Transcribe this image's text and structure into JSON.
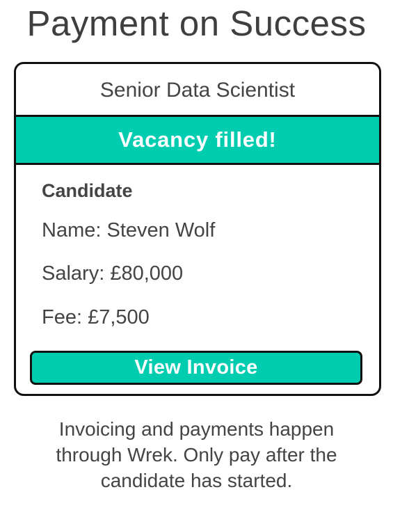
{
  "page": {
    "title": "Payment on Success"
  },
  "card": {
    "job_title": "Senior Data Scientist",
    "status": "Vacancy filled!",
    "candidate_heading": "Candidate",
    "name": "Name: Steven Wolf",
    "salary": "Salary: £80,000",
    "fee": "Fee: £7,500",
    "invoice_button_label": "View Invoice"
  },
  "footer": {
    "description": "Invoicing and payments happen through Wrek. Only pay after the candidate has started."
  },
  "colors": {
    "accent": "#00ccb0",
    "border": "#111111",
    "text": "#444444"
  }
}
